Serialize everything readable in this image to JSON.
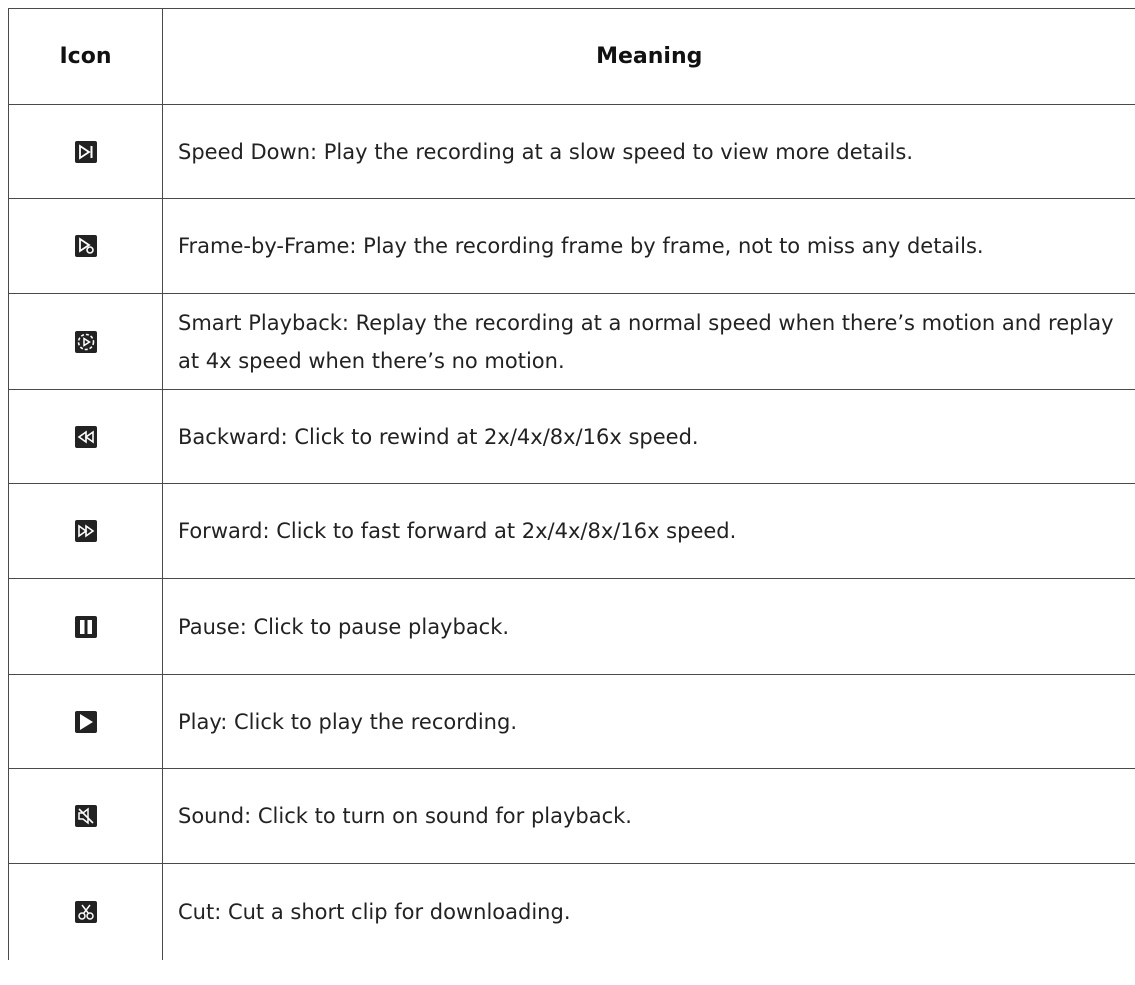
{
  "header": {
    "icon": "Icon",
    "meaning": "Meaning"
  },
  "rows": [
    {
      "icon": "speed-down-icon",
      "text": "Speed Down: Play the recording at a slow speed to view more details."
    },
    {
      "icon": "frame-by-frame-icon",
      "text": "Frame-by-Frame: Play the recording frame by frame, not to miss any details."
    },
    {
      "icon": "smart-playback-icon",
      "text": "Smart Playback: Replay the recording at a normal speed when there’s motion and replay at 4x speed when there’s no motion."
    },
    {
      "icon": "backward-icon",
      "text": "Backward: Click to rewind at 2x/4x/8x/16x speed."
    },
    {
      "icon": "forward-icon",
      "text": "Forward: Click to fast forward at 2x/4x/8x/16x speed."
    },
    {
      "icon": "pause-icon",
      "text": "Pause: Click to pause playback."
    },
    {
      "icon": "play-icon",
      "text": "Play: Click to play the recording."
    },
    {
      "icon": "sound-muted-icon",
      "text": "Sound: Click to turn on sound for playback."
    },
    {
      "icon": "cut-icon",
      "text": "Cut: Cut a short clip for downloading."
    }
  ]
}
